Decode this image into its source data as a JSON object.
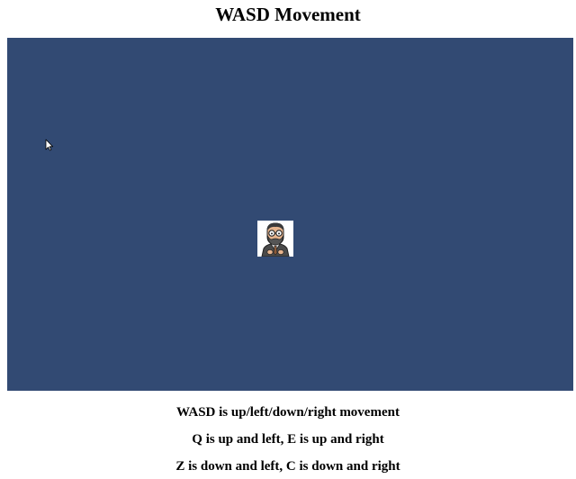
{
  "header": {
    "title": "WASD Movement"
  },
  "game": {
    "background_color": "#324a73",
    "player_icon": "bearded-man-with-glasses-avatar",
    "cursor_icon": "mouse-pointer-icon"
  },
  "instructions": {
    "line1": "WASD is up/left/down/right movement",
    "line2": "Q is up and left, E is up and right",
    "line3": "Z is down and left, C is down and right"
  }
}
